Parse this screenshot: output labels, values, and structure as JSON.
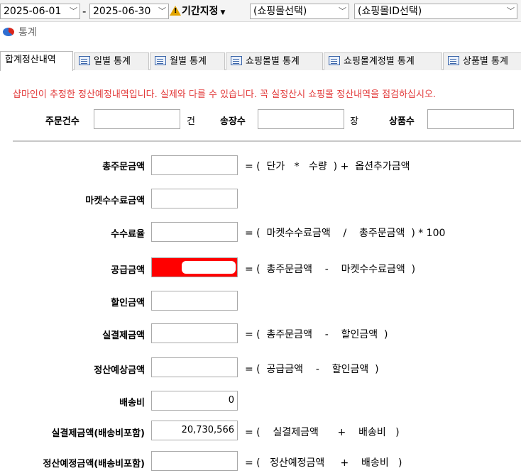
{
  "filters": {
    "start_date": "2025-06-01",
    "end_date": "2025-06-30",
    "range_separator": "-",
    "range_button_label": "기간지정",
    "shop_select": "(쇼핑몰선택)",
    "shop_id_select": "(쇼핑몰ID선택)"
  },
  "window": {
    "title": "통계"
  },
  "tabs": [
    {
      "label": "합계정산내역",
      "active": true
    },
    {
      "label": "일별 통계"
    },
    {
      "label": "월별 통계"
    },
    {
      "label": "쇼핑몰별 통계"
    },
    {
      "label": "쇼핑몰계정별 통계"
    },
    {
      "label": "상품별 통계"
    }
  ],
  "notice": "샵마인이 추정한 정산예정내역입니다. 실제와 다를 수 있습니다. 꼭 실정산시 쇼핑몰 정산내역을 점검하십시오.",
  "counts": {
    "order_count_label": "주문건수",
    "order_count_unit": "건",
    "order_count_value": "",
    "invoice_count_label": "송장수",
    "invoice_count_unit": "장",
    "invoice_count_value": "",
    "product_count_label": "상품수",
    "product_count_value": ""
  },
  "rows": [
    {
      "label": "총주문금액",
      "value": "",
      "formula": "= (  단가   *   수량  ) +  옵션추가금액"
    },
    {
      "label": "마켓수수료금액",
      "value": "",
      "formula": ""
    },
    {
      "label": "수수료율",
      "value": "",
      "formula": "= (  마켓수수료금액    /    총주문금액  ) * 100"
    },
    {
      "label": "공급금액",
      "value": "",
      "formula": "= (  총주문금액    -    마켓수수료금액  )",
      "highlight": "#ff0000"
    },
    {
      "label": "할인금액",
      "value": "",
      "formula": ""
    },
    {
      "label": "실결제금액",
      "value": "",
      "formula": "= (  총주문금액    -    할인금액  )"
    },
    {
      "label": "정산예상금액",
      "value": "",
      "formula": "= (  공급금액    -    할인금액  )"
    },
    {
      "label": "배송비",
      "value": "0",
      "formula": ""
    },
    {
      "label": "실결제금액(배송비포함)",
      "value": "20,730,566",
      "formula": "= (    실결제금액      +    배송비   )"
    },
    {
      "label": "정산예정금액(배송비포함)",
      "value": "",
      "formula": "= (   정산예정금액     +    배송비   )"
    }
  ],
  "icons": {
    "warning": "warning-icon",
    "window": "pie-chart-icon",
    "tab": "list-window-icon",
    "dropdown": "chevron-down-icon"
  }
}
